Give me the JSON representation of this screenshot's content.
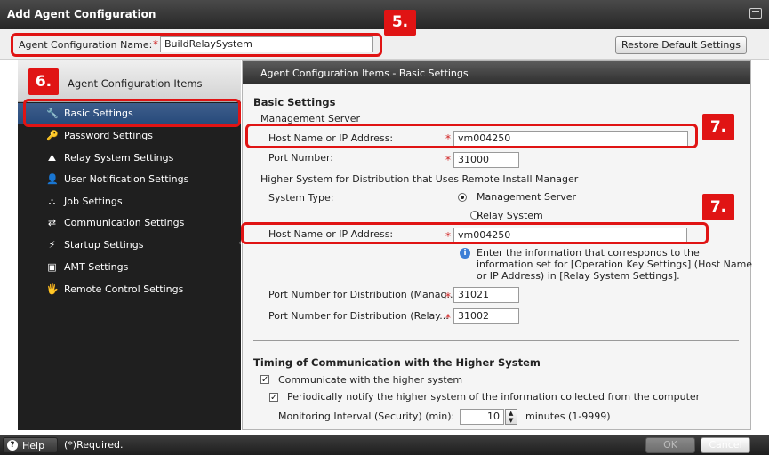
{
  "window": {
    "title": "Add Agent Configuration"
  },
  "name_row": {
    "label": "Agent Configuration Name:",
    "required_mark": "*",
    "value": "BuildRelaySystem",
    "restore_button": "Restore Default Settings"
  },
  "sidebar": {
    "header": "Agent Configuration Items",
    "items": [
      {
        "label": "Basic Settings",
        "icon": "wrench-icon",
        "glyph": "🔧"
      },
      {
        "label": "Password Settings",
        "icon": "key-icon",
        "glyph": "🔑"
      },
      {
        "label": "Relay System Settings",
        "icon": "relay-icon",
        "glyph": "⛰"
      },
      {
        "label": "User Notification Settings",
        "icon": "user-notification-icon",
        "glyph": "👤"
      },
      {
        "label": "Job Settings",
        "icon": "job-icon",
        "glyph": "⛬"
      },
      {
        "label": "Communication Settings",
        "icon": "communication-icon",
        "glyph": "⇄"
      },
      {
        "label": "Startup Settings",
        "icon": "startup-icon",
        "glyph": "⚡"
      },
      {
        "label": "AMT Settings",
        "icon": "amt-icon",
        "glyph": "▣"
      },
      {
        "label": "Remote Control Settings",
        "icon": "remote-control-icon",
        "glyph": "🖐"
      }
    ]
  },
  "panel": {
    "header": "Agent Configuration Items - Basic Settings",
    "section_basic": "Basic Settings",
    "mgmt_server": "Management Server",
    "host_label": "Host Name or IP Address:",
    "host_value": "vm004250",
    "port_label": "Port Number:",
    "port_value": "31000",
    "higher_system": "Higher System for Distribution that Uses Remote Install Manager",
    "system_type_label": "System Type:",
    "radio_mgmt": "Management Server",
    "radio_relay": "Relay System",
    "host2_label": "Host Name or IP Address:",
    "host2_value": "vm004250",
    "info_text_1": "Enter the information that corresponds to the",
    "info_text_2": "information set for [Operation Key Settings] (Host Name",
    "info_text_3": "or IP Address) in [Relay System Settings].",
    "port_dist_mgr_label": "Port Number for Distribution (Manag...",
    "port_dist_mgr_value": "31021",
    "port_dist_relay_label": "Port Number for Distribution (Relay...",
    "port_dist_relay_value": "31002",
    "section_timing": "Timing of Communication with the Higher System",
    "chk_communicate": "Communicate with the higher system",
    "chk_notify": "Periodically notify the higher system of the information collected from the computer",
    "monitor_label": "Monitoring Interval (Security) (min):",
    "monitor_value": "10",
    "monitor_unit": "minutes (1-9999)"
  },
  "callouts": {
    "c5": "5.",
    "c6": "6.",
    "c7a": "7.",
    "c7b": "7."
  },
  "footer": {
    "help": "Help",
    "required_note": "(*)Required.",
    "ok": "OK",
    "cancel": "Cancel"
  },
  "colors": {
    "accent_red": "#e01414",
    "selection_blue": "#2f5588",
    "dark_bg": "#1f1f1f"
  }
}
